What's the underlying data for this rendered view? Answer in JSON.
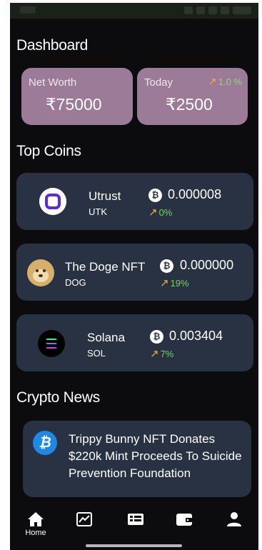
{
  "dashboard": {
    "title": "Dashboard",
    "net_worth": {
      "label": "Net Worth",
      "value": "₹75000"
    },
    "today": {
      "label": "Today",
      "change": "1.0 %",
      "value": "₹2500"
    }
  },
  "top_coins": {
    "title": "Top Coins",
    "coins": [
      {
        "name": "Utrust",
        "symbol": "UTK",
        "price": "0.000008",
        "change": "0%"
      },
      {
        "name": "The Doge NFT",
        "symbol": "DOG",
        "price": "0.000000",
        "change": "19%"
      },
      {
        "name": "Solana",
        "symbol": "SOL",
        "price": "0.003404",
        "change": "7%"
      }
    ]
  },
  "news": {
    "title": "Crypto News",
    "items": [
      {
        "headline": "Trippy Bunny NFT Donates $220k Mint Proceeds To Suicide Prevention Foundation"
      }
    ]
  },
  "nav": {
    "items": [
      {
        "label": "Home",
        "icon": "home-icon"
      },
      {
        "label": "",
        "icon": "chart-icon"
      },
      {
        "label": "",
        "icon": "news-list-icon"
      },
      {
        "label": "",
        "icon": "wallet-icon"
      },
      {
        "label": "",
        "icon": "profile-icon"
      }
    ]
  },
  "colors": {
    "background": "#0c0c0e",
    "summary_card": "#9c7b98",
    "coin_card": "#283242",
    "positive": "#79d35d",
    "arrow": "#e9b23c",
    "news_icon": "#1e88e5"
  }
}
